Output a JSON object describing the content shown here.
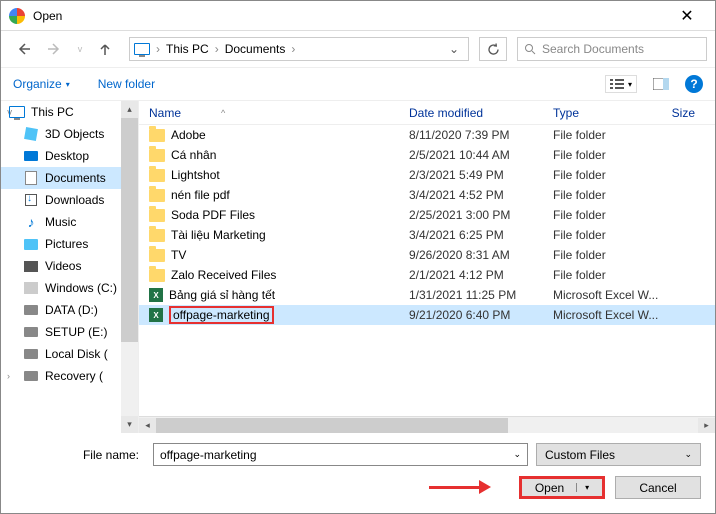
{
  "window": {
    "title": "Open",
    "close": "✕"
  },
  "nav": {
    "breadcrumb": [
      "This PC",
      "Documents"
    ],
    "search_placeholder": "Search Documents"
  },
  "toolbar": {
    "organize": "Organize",
    "new_folder": "New folder",
    "help": "?"
  },
  "sidebar": {
    "items": [
      {
        "label": "This PC",
        "icon": "pc",
        "top": true,
        "caret": "ⅴ"
      },
      {
        "label": "3D Objects",
        "icon": "cube"
      },
      {
        "label": "Desktop",
        "icon": "desk"
      },
      {
        "label": "Documents",
        "icon": "doc",
        "selected": true
      },
      {
        "label": "Downloads",
        "icon": "dl"
      },
      {
        "label": "Music",
        "icon": "music"
      },
      {
        "label": "Pictures",
        "icon": "pic"
      },
      {
        "label": "Videos",
        "icon": "vid"
      },
      {
        "label": "Windows (C:)",
        "icon": "win"
      },
      {
        "label": "DATA (D:)",
        "icon": "drive"
      },
      {
        "label": "SETUP (E:)",
        "icon": "drive"
      },
      {
        "label": "Local Disk (",
        "icon": "drive"
      },
      {
        "label": "Recovery (",
        "icon": "drive",
        "caret": "›"
      }
    ]
  },
  "columns": {
    "name": "Name",
    "date": "Date modified",
    "type": "Type",
    "size": "Size"
  },
  "files": [
    {
      "name": "Adobe",
      "date": "8/11/2020 7:39 PM",
      "type": "File folder",
      "icon": "folder"
    },
    {
      "name": "Cá nhân",
      "date": "2/5/2021 10:44 AM",
      "type": "File folder",
      "icon": "folder"
    },
    {
      "name": "Lightshot",
      "date": "2/3/2021 5:49 PM",
      "type": "File folder",
      "icon": "folder"
    },
    {
      "name": "nén file pdf",
      "date": "3/4/2021 4:52 PM",
      "type": "File folder",
      "icon": "folder"
    },
    {
      "name": "Soda PDF Files",
      "date": "2/25/2021 3:00 PM",
      "type": "File folder",
      "icon": "folder"
    },
    {
      "name": "Tài liệu Marketing",
      "date": "3/4/2021 6:25 PM",
      "type": "File folder",
      "icon": "folder"
    },
    {
      "name": "TV",
      "date": "9/26/2020 8:31 AM",
      "type": "File folder",
      "icon": "folder"
    },
    {
      "name": "Zalo Received Files",
      "date": "2/1/2021 4:12 PM",
      "type": "File folder",
      "icon": "folder"
    },
    {
      "name": "Bảng giá sỉ hàng tết",
      "date": "1/31/2021 11:25 PM",
      "type": "Microsoft Excel W...",
      "icon": "excel"
    },
    {
      "name": "offpage-marketing",
      "date": "9/21/2020 6:40 PM",
      "type": "Microsoft Excel W...",
      "icon": "excel",
      "selected": true,
      "highlight": true
    }
  ],
  "bottom": {
    "file_name_label": "File name:",
    "file_name_value": "offpage-marketing",
    "filter": "Custom Files",
    "open": "Open",
    "cancel": "Cancel"
  }
}
